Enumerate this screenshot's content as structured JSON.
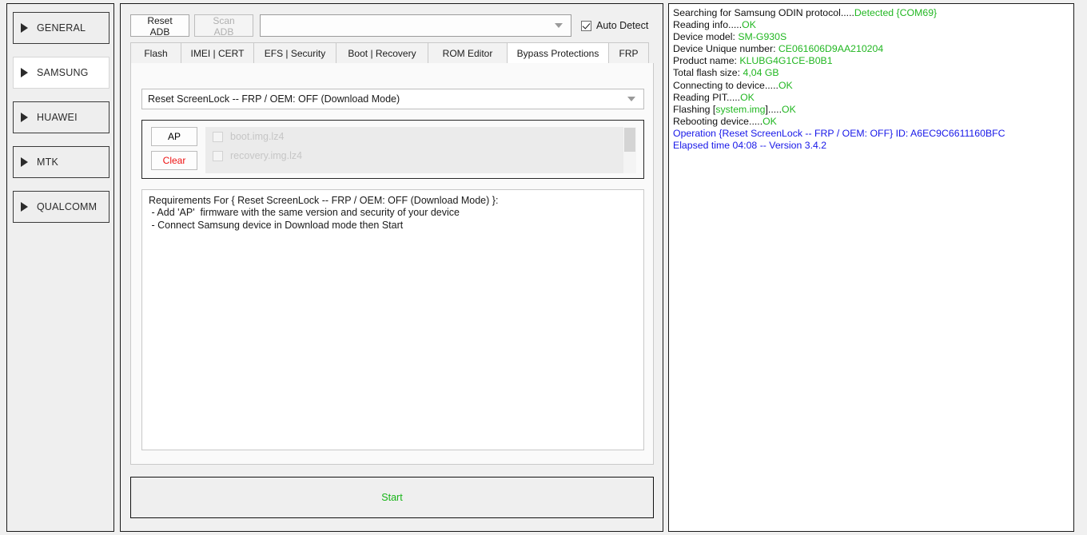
{
  "sidebar": {
    "items": [
      {
        "label": "GENERAL",
        "icon": "triangle-right-icon",
        "selected": false
      },
      {
        "label": "SAMSUNG",
        "icon": "triangle-right-icon",
        "selected": true
      },
      {
        "label": "HUAWEI",
        "icon": "triangle-right-icon",
        "selected": false
      },
      {
        "label": "MTK",
        "icon": "triangle-right-icon",
        "selected": false
      },
      {
        "label": "QUALCOMM",
        "icon": "triangle-right-icon",
        "selected": false
      }
    ]
  },
  "toolbar": {
    "reset_adb_label": "Reset ADB",
    "scan_adb_label": "Scan ADB",
    "scan_adb_enabled": false,
    "device_combo_value": "",
    "device_combo_icon": "chevron-down-icon",
    "auto_detect_label": "Auto Detect",
    "auto_detect_checked": true
  },
  "tabs": [
    {
      "label": "Flash",
      "active": false
    },
    {
      "label": "IMEI | CERT",
      "active": false
    },
    {
      "label": "EFS | Security",
      "active": false
    },
    {
      "label": "Boot | Recovery",
      "active": false
    },
    {
      "label": "ROM Editor",
      "active": false
    },
    {
      "label": "Bypass Protections",
      "active": true
    },
    {
      "label": "FRP",
      "active": false
    }
  ],
  "operation": {
    "selected": "Reset ScreenLock -- FRP / OEM: OFF (Download Mode)",
    "dropdown_icon": "chevron-down-icon"
  },
  "firmware": {
    "ap_button_label": "AP",
    "clear_button_label": "Clear",
    "clear_button_color": "#ee1111",
    "files": [
      {
        "name": "boot.img.lz4",
        "checked": false,
        "enabled": false
      },
      {
        "name": "recovery.img.lz4",
        "checked": false,
        "enabled": false
      }
    ]
  },
  "requirements": {
    "lines": [
      "Requirements For { Reset ScreenLock -- FRP / OEM: OFF (Download Mode) }:",
      " - Add 'AP'  firmware with the same version and security of your device",
      " - Connect Samsung device in Download mode then Start"
    ]
  },
  "start_button": {
    "label": "Start",
    "color": "#17b417"
  },
  "log": {
    "lines": [
      [
        {
          "t": "Searching for Samsung ODIN protocol.....",
          "c": "k"
        },
        {
          "t": "Detected {COM69}",
          "c": "g"
        }
      ],
      [
        {
          "t": "Reading info.....",
          "c": "k"
        },
        {
          "t": "OK",
          "c": "g"
        }
      ],
      [
        {
          "t": "Device model: ",
          "c": "k"
        },
        {
          "t": "SM-G930S",
          "c": "g"
        }
      ],
      [
        {
          "t": "Device Unique number: ",
          "c": "k"
        },
        {
          "t": "CE061606D9AA210204",
          "c": "g"
        }
      ],
      [
        {
          "t": "Product name: ",
          "c": "k"
        },
        {
          "t": "KLUBG4G1CE-B0B1",
          "c": "g"
        }
      ],
      [
        {
          "t": "Total flash size: ",
          "c": "k"
        },
        {
          "t": "4,04 GB",
          "c": "g"
        }
      ],
      [
        {
          "t": "Connecting to device.....",
          "c": "k"
        },
        {
          "t": "OK",
          "c": "g"
        }
      ],
      [
        {
          "t": "Reading PIT.....",
          "c": "k"
        },
        {
          "t": "OK",
          "c": "g"
        }
      ],
      [
        {
          "t": "Flashing [",
          "c": "k"
        },
        {
          "t": "system.img",
          "c": "g"
        },
        {
          "t": "].....",
          "c": "k"
        },
        {
          "t": "OK",
          "c": "g"
        }
      ],
      [
        {
          "t": "Rebooting device.....",
          "c": "k"
        },
        {
          "t": "OK",
          "c": "g"
        }
      ],
      [
        {
          "t": "Operation {Reset ScreenLock -- FRP / OEM: OFF} ID: A6EC9C6611160BFC",
          "c": "b"
        }
      ],
      [
        {
          "t": "Elapsed time 04:08 -- Version 3.4.2",
          "c": "b"
        }
      ]
    ]
  },
  "colors": {
    "success": "#22b722",
    "info": "#1717e8",
    "danger": "#ee1111",
    "start": "#17b417"
  }
}
